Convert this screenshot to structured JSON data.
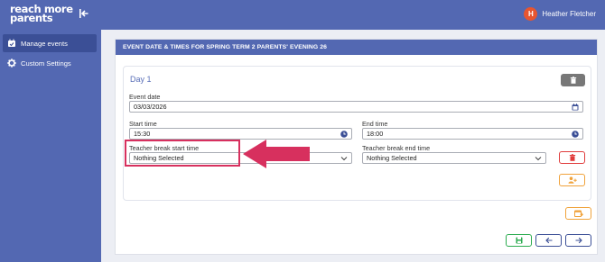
{
  "app": {
    "logo_line1": "reach more",
    "logo_line2": "parents",
    "user_initial": "H",
    "user_name": "Heather Fletcher"
  },
  "sidebar": {
    "items": [
      {
        "label": "Manage events",
        "icon": "calendar-check-icon",
        "active": true
      },
      {
        "label": "Custom Settings",
        "icon": "gear-icon",
        "active": false
      }
    ]
  },
  "panel": {
    "title": "EVENT DATE & TIMES FOR SPRING TERM 2 PARENTS' EVENING 26"
  },
  "day": {
    "title": "Day 1",
    "event_date_label": "Event date",
    "event_date_value": "03/03/2026",
    "start_time_label": "Start time",
    "start_time_value": "15:30",
    "end_time_label": "End time",
    "end_time_value": "18:00",
    "break_start_label": "Teacher break start time",
    "break_start_value": "Nothing Selected",
    "break_end_label": "Teacher break end time",
    "break_end_value": "Nothing Selected"
  },
  "colors": {
    "brand": "#5368b2",
    "brand_dark": "#3b4f96",
    "danger": "#e03c3c",
    "warning": "#f0a23a",
    "success": "#2bab4f",
    "navy": "#3b4f96",
    "highlight": "#d7305e"
  }
}
